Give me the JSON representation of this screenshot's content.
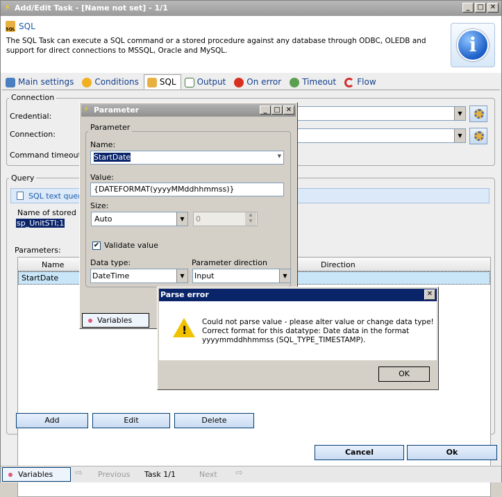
{
  "window": {
    "title": "Add/Edit Task - [Name not set] - 1/1",
    "minimize": "_",
    "maximize": "□",
    "close": "✕"
  },
  "header": {
    "title": "SQL",
    "description": "The SQL Task can execute a SQL command or a stored procedure against any database through ODBC, OLEDB and support for direct connections to MSSQL, Oracle and MySQL.",
    "icon_label": "SQL",
    "info_glyph": "i"
  },
  "tabs": [
    {
      "label": "Main settings"
    },
    {
      "label": "Conditions"
    },
    {
      "label": "SQL"
    },
    {
      "label": "Output"
    },
    {
      "label": "On error"
    },
    {
      "label": "Timeout"
    },
    {
      "label": "Flow"
    }
  ],
  "connection": {
    "group": "Connection",
    "credential_label": "Credential:",
    "connection_label": "Connection:",
    "timeout_label": "Command timeout:"
  },
  "query": {
    "group": "Query",
    "sql_text_tab": "SQL text query",
    "stored_proc_label": "Name of stored pro",
    "stored_proc_value": "sp_UnitSTI;1",
    "parameters_label": "Parameters:",
    "columns": [
      "Name",
      "Direction"
    ],
    "rows": [
      {
        "name": "StartDate"
      }
    ],
    "add": "Add",
    "edit": "Edit",
    "delete": "Delete"
  },
  "footer": {
    "cancel": "Cancel",
    "ok": "Ok"
  },
  "statusbar": {
    "variables": "Variables",
    "previous": "Previous",
    "task": "Task 1/1",
    "next": "Next"
  },
  "parameter_dialog": {
    "title": "Parameter",
    "group": "Parameter",
    "name_label": "Name:",
    "name_value": "StartDate",
    "value_label": "Value:",
    "value_value": "{DATEFORMAT(yyyyMMddhhmmss)}",
    "size_label": "Size:",
    "size_value": "Auto",
    "size_number": "0",
    "validate_label": "Validate value",
    "datatype_label": "Data type:",
    "datatype_value": "DateTime",
    "direction_label": "Parameter direction",
    "direction_value": "Input",
    "variables": "Variables"
  },
  "error_dialog": {
    "title": "Parse error",
    "line1": "Could not parse value - please alter value or change data type!",
    "line2": "Correct format for this datatype: Date data in the format",
    "line3": "yyyymmddhhmmss (SQL_TYPE_TIMESTAMP).",
    "ok": "OK",
    "close": "✕"
  }
}
